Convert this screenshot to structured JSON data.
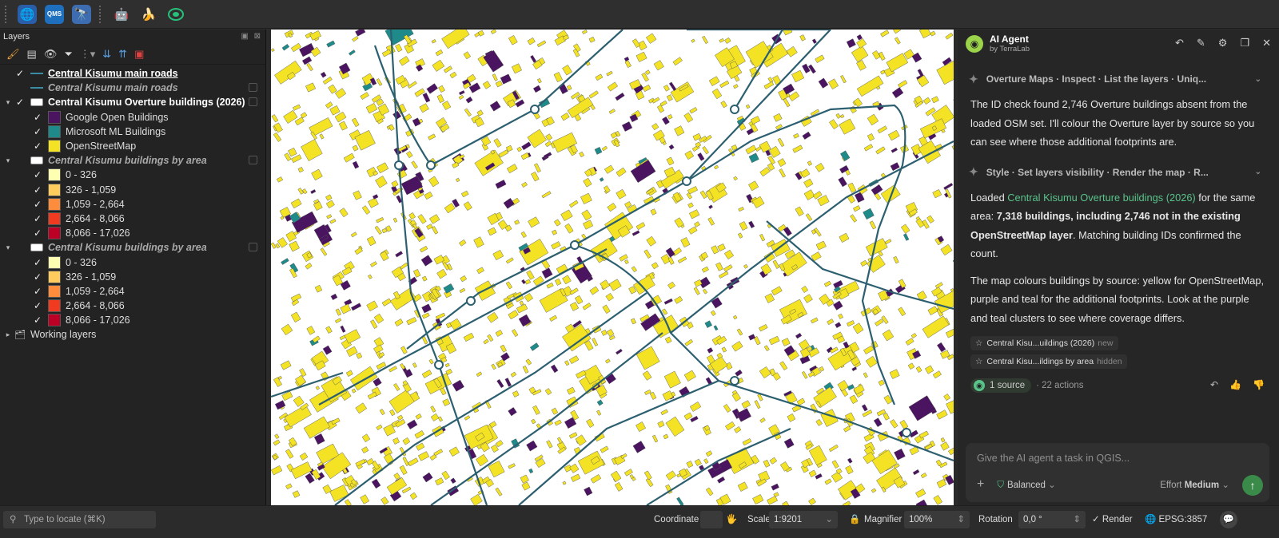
{
  "toolbar": {
    "icons": [
      "globe-add-icon",
      "qms-icon",
      "globe-binoculars-icon",
      "robot-icon",
      "banana-icon",
      "terralab-icon"
    ],
    "qms_label": "QMS"
  },
  "layers_panel": {
    "title": "Layers",
    "items": [
      {
        "label": "Central Kisumu main roads",
        "kind": "line",
        "checked": true,
        "style": "b u"
      },
      {
        "label": "Central Kisumu main roads",
        "kind": "line",
        "checked": false,
        "style": "i"
      },
      {
        "label": "Central Kisumu Overture buildings (2026)",
        "kind": "poly",
        "checked": true,
        "style": "b",
        "expanded": true
      },
      {
        "label": "Google Open Buildings",
        "kind": "swatch",
        "color": "#4b1460",
        "checked": true,
        "indent": 1
      },
      {
        "label": "Microsoft ML Buildings",
        "kind": "swatch",
        "color": "#1f8a8a",
        "checked": true,
        "indent": 1
      },
      {
        "label": "OpenStreetMap",
        "kind": "swatch",
        "color": "#f3e324",
        "checked": true,
        "indent": 1
      },
      {
        "label": "Central Kisumu buildings by area",
        "kind": "poly",
        "checked": false,
        "style": "i",
        "expanded": true
      },
      {
        "label": "0 - 326",
        "kind": "swatch",
        "color": "#ffffb2",
        "checked": true,
        "indent": 1
      },
      {
        "label": "326 - 1,059",
        "kind": "swatch",
        "color": "#fecc5c",
        "checked": true,
        "indent": 1
      },
      {
        "label": "1,059 - 2,664",
        "kind": "swatch",
        "color": "#fd8d3c",
        "checked": true,
        "indent": 1
      },
      {
        "label": "2,664 - 8,066",
        "kind": "swatch",
        "color": "#f03b20",
        "checked": true,
        "indent": 1
      },
      {
        "label": "8,066 - 17,026",
        "kind": "swatch",
        "color": "#bd0026",
        "checked": true,
        "indent": 1
      },
      {
        "label": "Central Kisumu buildings by area",
        "kind": "poly",
        "checked": false,
        "style": "i",
        "expanded": true
      },
      {
        "label": "0 - 326",
        "kind": "swatch",
        "color": "#ffffb2",
        "checked": true,
        "indent": 1
      },
      {
        "label": "326 - 1,059",
        "kind": "swatch",
        "color": "#fecc5c",
        "checked": true,
        "indent": 1
      },
      {
        "label": "1,059 - 2,664",
        "kind": "swatch",
        "color": "#fd8d3c",
        "checked": true,
        "indent": 1
      },
      {
        "label": "2,664 - 8,066",
        "kind": "swatch",
        "color": "#f03b20",
        "checked": true,
        "indent": 1
      },
      {
        "label": "8,066 - 17,026",
        "kind": "swatch",
        "color": "#bd0026",
        "checked": true,
        "indent": 1
      },
      {
        "label": "Working layers",
        "kind": "group",
        "checked": null,
        "style": ""
      }
    ]
  },
  "agent": {
    "title": "AI Agent",
    "subtitle": "by TerraLab",
    "step1": "Overture Maps · Inspect · List the layers · Uniq...",
    "para1": "The ID check found 2,746 Overture buildings absent from the loaded OSM set. I'll colour the Overture layer by source so you can see where those additional footprints are.",
    "step2": "Style · Set layers visibility · Render the map · R...",
    "para2_pre": "Loaded ",
    "para2_link": "Central Kisumu Overture buildings (2026)",
    "para2_mid": " for the same area: ",
    "para2_bold": "7,318 buildings, including 2,746 not in the existing OpenStreetMap layer",
    "para2_post": ". Matching building IDs confirmed the count.",
    "para3": "The map colours buildings by source: yellow for OpenStreetMap, purple and teal for the additional footprints. Look at the purple and teal clusters to see where coverage differs.",
    "chip1": "Central Kisu...uildings (2026)",
    "chip1_tag": "new",
    "chip2": "Central Kisu...ildings by area",
    "chip2_tag": "hidden",
    "sources": "1 source",
    "actions": "· 22 actions",
    "composer_placeholder": "Give the AI agent a task in QGIS...",
    "mode": "Balanced",
    "effort_label": "Effort",
    "effort_value": "Medium"
  },
  "status": {
    "locate_placeholder": "Type to locate (⌘K)",
    "coordinate_label": "Coordinate",
    "scale_label": "Scale",
    "scale_value": "1:9201",
    "magnifier_label": "Magnifier",
    "magnifier_value": "100%",
    "rotation_label": "Rotation",
    "rotation_value": "0,0 °",
    "render_label": "Render",
    "crs": "EPSG:3857"
  },
  "colors": {
    "osm": "#f3e324",
    "google": "#4b1460",
    "microsoft": "#1f8a8a",
    "roads": "#2c5f70"
  }
}
